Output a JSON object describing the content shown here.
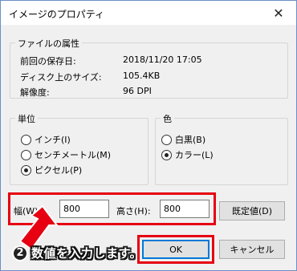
{
  "window": {
    "title": "イメージのプロパティ",
    "close_glyph": "✕"
  },
  "file_attrs": {
    "group_label": "ファイルの属性",
    "rows": [
      {
        "key": "前回の保存日:",
        "value": "2018/11/20 17:05"
      },
      {
        "key": "ディスク上のサイズ:",
        "value": "105.4KB"
      },
      {
        "key": "解像度:",
        "value": "96 DPI"
      }
    ]
  },
  "units": {
    "group_label": "単位",
    "options": [
      {
        "label": "インチ(I)",
        "checked": false
      },
      {
        "label": "センチメートル(M)",
        "checked": false
      },
      {
        "label": "ピクセル(P)",
        "checked": true
      }
    ]
  },
  "color": {
    "group_label": "色",
    "options": [
      {
        "label": "白黒(B)",
        "checked": false
      },
      {
        "label": "カラー(L)",
        "checked": true
      }
    ]
  },
  "size": {
    "width_label": "幅(W):",
    "width_value": "800",
    "height_label": "高さ(H):",
    "height_value": "800"
  },
  "buttons": {
    "default_label": "既定値(D)",
    "ok_label": "OK",
    "cancel_label": "キャンセル"
  },
  "annotation": {
    "step_number": "2",
    "text": "数値を入力します。",
    "accent_color": "#e60012"
  }
}
